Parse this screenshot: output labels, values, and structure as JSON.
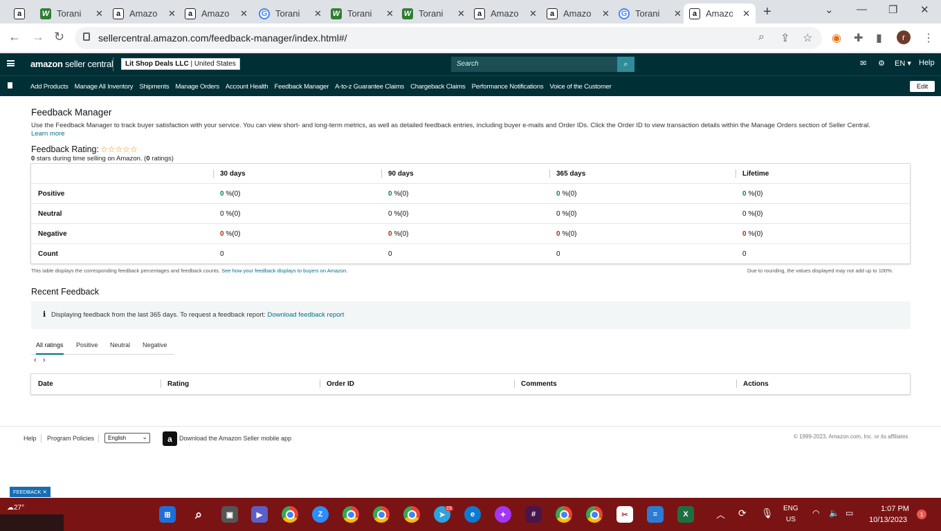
{
  "browser": {
    "tabs": [
      {
        "icon": "amazon-favicon",
        "title": "",
        "active": false
      },
      {
        "icon": "torani-favicon",
        "title": "Torani",
        "active": false
      },
      {
        "icon": "amazon-favicon",
        "title": "Amazo",
        "active": false
      },
      {
        "icon": "amazon-favicon",
        "title": "Amazo",
        "active": false
      },
      {
        "icon": "google-favicon",
        "title": "Torani",
        "active": false
      },
      {
        "icon": "torani-favicon",
        "title": "Torani",
        "active": false
      },
      {
        "icon": "torani-favicon",
        "title": "Torani",
        "active": false
      },
      {
        "icon": "amazon-favicon",
        "title": "Amazo",
        "active": false
      },
      {
        "icon": "amazon-favicon",
        "title": "Amazo",
        "active": false
      },
      {
        "icon": "google-favicon",
        "title": "Torani",
        "active": false
      },
      {
        "icon": "amazon-favicon",
        "title": "Amazo",
        "active": true
      }
    ],
    "url": "sellercentral.amazon.com/feedback-manager/index.html#/",
    "profile_initial": "r"
  },
  "header": {
    "logo_bold": "amazon",
    "logo_rest": " seller central",
    "account_name": "Lit Shop Deals LLC",
    "account_region": "United States",
    "search_placeholder": "Search",
    "lang": "EN",
    "help": "Help"
  },
  "nav": {
    "items": [
      "Add Products",
      "Manage All Inventory",
      "Shipments",
      "Manage Orders",
      "Account Health",
      "Feedback Manager",
      "A-to-z Guarantee Claims",
      "Chargeback Claims",
      "Performance Notifications",
      "Voice of the Customer"
    ],
    "edit": "Edit"
  },
  "main": {
    "title": "Feedback Manager",
    "intro": "Use the Feedback Manager to track buyer satisfaction with your service. You can view short- and long-term metrics, as well as detailed feedback entries, including buyer e-mails and Order IDs. Click the Order ID to view transaction details within the Manage Orders section of Seller Central.",
    "learn_more": "Learn more",
    "rating_label": "Feedback Rating:",
    "stars": "☆☆☆☆☆",
    "rating_stars_count": "0",
    "rating_note_mid": " stars during time selling on Amazon. (",
    "rating_count": "0",
    "rating_note_end": " ratings)"
  },
  "feedback_table": {
    "columns": [
      "30 days",
      "90 days",
      "365 days",
      "Lifetime"
    ],
    "rows": [
      {
        "label": "Positive",
        "cells": [
          {
            "n": "0",
            "p": " %(0)"
          },
          {
            "n": "0",
            "p": " %(0)"
          },
          {
            "n": "0",
            "p": " %(0)"
          },
          {
            "n": "0",
            "p": " %(0)"
          }
        ]
      },
      {
        "label": "Neutral",
        "cells": [
          {
            "n": "0",
            "p": " %(0)"
          },
          {
            "n": "0",
            "p": " %(0)"
          },
          {
            "n": "0",
            "p": " %(0)"
          },
          {
            "n": "0",
            "p": " %(0)"
          }
        ]
      },
      {
        "label": "Negative",
        "cells": [
          {
            "n": "0",
            "p": " %(0)"
          },
          {
            "n": "0",
            "p": " %(0)"
          },
          {
            "n": "0",
            "p": " %(0)"
          },
          {
            "n": "0",
            "p": " %(0)"
          }
        ]
      },
      {
        "label": "Count",
        "cells": [
          {
            "n": "0",
            "p": ""
          },
          {
            "n": "0",
            "p": ""
          },
          {
            "n": "0",
            "p": ""
          },
          {
            "n": "0",
            "p": ""
          }
        ]
      }
    ],
    "note": "This table displays the corresponding feedback percentages and feedback counts.",
    "note_link": "See how your feedback displays to buyers on Amazon.",
    "rounding_note": "Due to rounding, the values displayed may not add up to 100%."
  },
  "recent": {
    "title": "Recent Feedback",
    "info": "Displaying feedback from the last 365 days. To request a feedback report:",
    "info_link": "Download feedback report",
    "tabs": [
      "All ratings",
      "Positive",
      "Neutral",
      "Negative"
    ],
    "columns": [
      "Date",
      "Rating",
      "Order ID",
      "Comments",
      "Actions"
    ]
  },
  "footer": {
    "help": "Help",
    "policies": "Program Policies",
    "language": "English",
    "app_text": "Download the Amazon Seller mobile app",
    "copyright": "© 1999-2023, Amazon.com, Inc. or its affiliates",
    "feedback_tag": "FEEDBACK"
  },
  "taskbar": {
    "weather": "27°",
    "telegram_badge": "23",
    "lang_top": "ENG",
    "lang_bottom": "US",
    "time": "1:07 PM",
    "date": "10/13/2023",
    "notifications": "1"
  }
}
